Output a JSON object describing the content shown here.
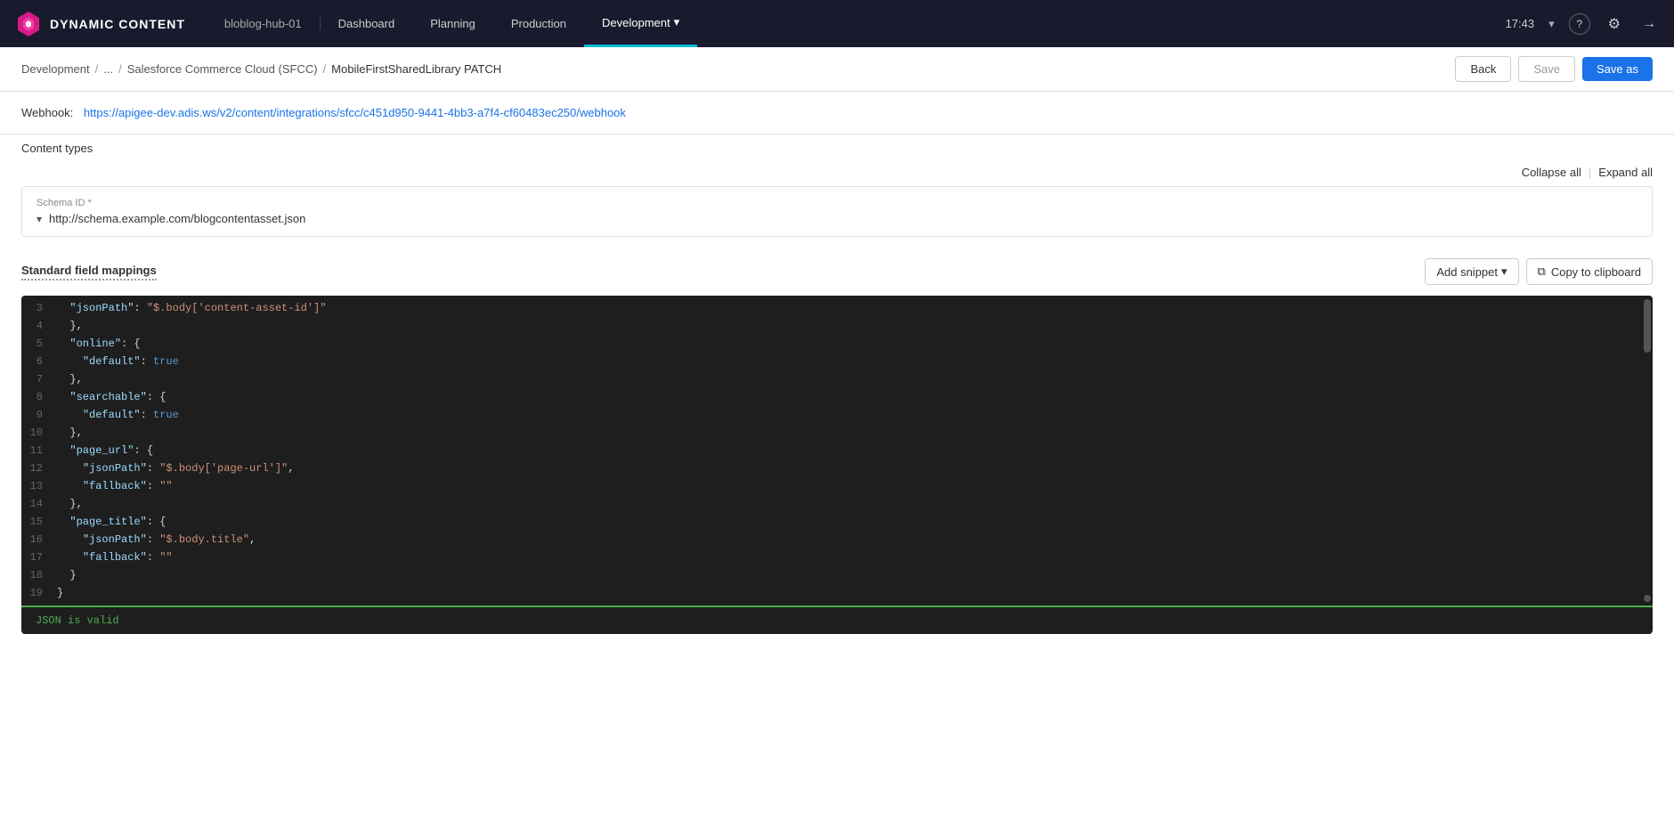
{
  "app": {
    "name": "DYNAMIC CONTENT",
    "hub": "bloblog-hub-01",
    "time": "17:43"
  },
  "nav": {
    "tabs": [
      {
        "label": "Dashboard",
        "active": false
      },
      {
        "label": "Planning",
        "active": false
      },
      {
        "label": "Production",
        "active": false
      },
      {
        "label": "Development",
        "active": true,
        "hasDropdown": true
      }
    ]
  },
  "breadcrumb": {
    "items": [
      {
        "label": "Development",
        "link": true
      },
      {
        "label": "...",
        "link": true
      },
      {
        "label": "Salesforce Commerce Cloud (SFCC)",
        "link": true
      },
      {
        "label": "MobileFirstSharedLibrary PATCH",
        "link": false
      }
    ],
    "back_label": "Back",
    "save_label": "Save",
    "save_as_label": "Save as"
  },
  "webhook": {
    "label": "Webhook:",
    "url": "https://apigee-dev.adis.ws/v2/content/integrations/sfcc/c451d950-9441-4bb3-a7f4-cf60483ec250/webhook"
  },
  "content_types": {
    "label": "Content types"
  },
  "controls": {
    "collapse_all": "Collapse all",
    "expand_all": "Expand all",
    "separator": "|"
  },
  "schema": {
    "id_label": "Schema ID *",
    "value": "http://schema.example.com/blogcontentasset.json"
  },
  "field_mappings": {
    "title": "Standard field mappings",
    "add_snippet": "Add snippet",
    "copy_to_clipboard": "Copy to clipboard"
  },
  "code": {
    "lines": [
      {
        "num": 3,
        "content": "  \"jsonPath\": \"$.body['content-asset-id']\""
      },
      {
        "num": 4,
        "content": "  },"
      },
      {
        "num": 5,
        "content": "  \"online\": {"
      },
      {
        "num": 6,
        "content": "    \"default\": true"
      },
      {
        "num": 7,
        "content": "  },"
      },
      {
        "num": 8,
        "content": "  \"searchable\": {"
      },
      {
        "num": 9,
        "content": "    \"default\": true"
      },
      {
        "num": 10,
        "content": "  },"
      },
      {
        "num": 11,
        "content": "  \"page_url\": {"
      },
      {
        "num": 12,
        "content": "    \"jsonPath\": \"$.body['page-url']\","
      },
      {
        "num": 13,
        "content": "    \"fallback\": \"\""
      },
      {
        "num": 14,
        "content": "  },"
      },
      {
        "num": 15,
        "content": "  \"page_title\": {"
      },
      {
        "num": 16,
        "content": "    \"jsonPath\": \"$.body.title\","
      },
      {
        "num": 17,
        "content": "    \"fallback\": \"\""
      },
      {
        "num": 18,
        "content": "  }"
      },
      {
        "num": 19,
        "content": "}"
      }
    ]
  },
  "status": {
    "message": "JSON is valid"
  },
  "icons": {
    "dropdown_arrow": "▾",
    "chevron_down": "▾",
    "help": "?",
    "settings": "⚙",
    "logout": "→",
    "copy": "⧉",
    "clock": "🕐"
  }
}
